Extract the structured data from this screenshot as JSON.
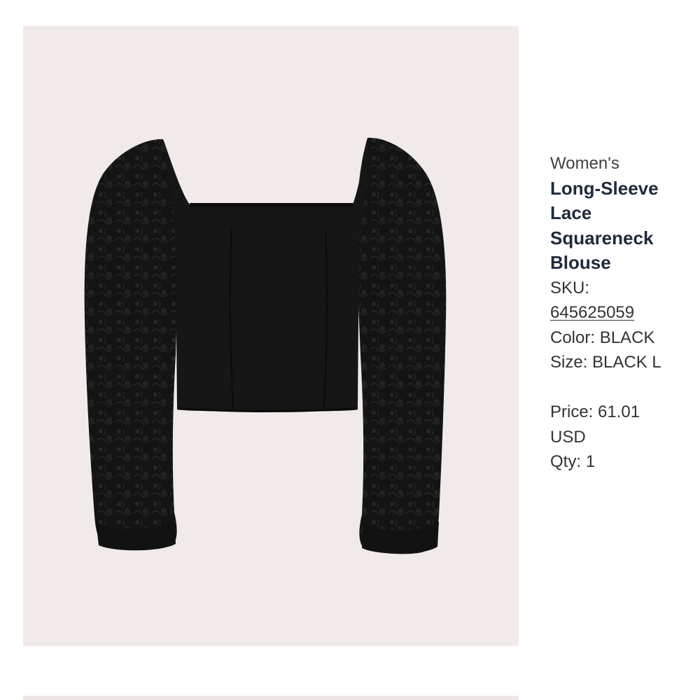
{
  "product": {
    "gender": "Women's",
    "name": "Long-Sleeve Lace Squareneck Blouse",
    "sku_label": "SKU:",
    "sku_value": "645625059",
    "color_label": "Color:",
    "color_value": "BLACK",
    "size_label": "Size:",
    "size_value": "BLACK L",
    "price_label": "Price:",
    "price_value": "61.01 USD",
    "qty_label": "Qty:",
    "qty_value": "1"
  },
  "image": {
    "background_color": "#f0ebe9",
    "garment_color": "#161616"
  }
}
